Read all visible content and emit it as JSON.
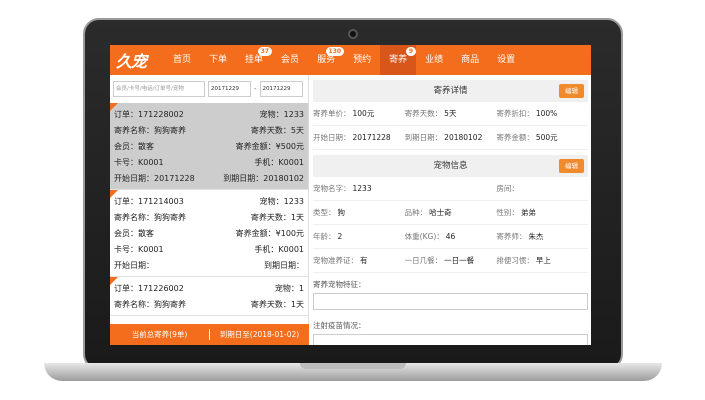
{
  "app": {
    "logo": "久宠",
    "nav": [
      {
        "label": "首页",
        "badge": null
      },
      {
        "label": "下单",
        "badge": null
      },
      {
        "label": "挂单",
        "badge": "37"
      },
      {
        "label": "会员",
        "badge": null
      },
      {
        "label": "服务",
        "badge": "130"
      },
      {
        "label": "预约",
        "badge": null
      },
      {
        "label": "寄养",
        "badge": "9"
      },
      {
        "label": "业绩",
        "badge": null
      },
      {
        "label": "商品",
        "badge": null
      },
      {
        "label": "设置",
        "badge": null
      }
    ],
    "active_nav": "寄养"
  },
  "filters": {
    "search_placeholder": "会员/卡号/电话/订单号/宠物",
    "date_from": "20171229",
    "date_sep": "-",
    "date_to": "20171229"
  },
  "orders": [
    {
      "order_label": "订单：171228002",
      "pets_label": "宠物：1233",
      "name_label": "寄养名称：狗狗寄养",
      "days_label": "寄养天数：5天",
      "member_label": "会员：散客",
      "amount_label": "寄养金额：¥500元",
      "card_label": "卡号：K0001",
      "phone_label": "手机：K0001",
      "start_label": "开始日期：20171228",
      "end_label": "到期日期：20180102"
    },
    {
      "order_label": "订单：171214003",
      "pets_label": "宠物：1233",
      "name_label": "寄养名称：狗狗寄养",
      "days_label": "寄养天数：1天",
      "member_label": "会员：散客",
      "amount_label": "寄养金额：¥100元",
      "card_label": "卡号：K0001",
      "phone_label": "手机：K0001",
      "start_label": "开始日期：",
      "end_label": "到期日期："
    },
    {
      "order_label": "订单：171226002",
      "pets_label": "宠物：1",
      "name_label": "寄养名称：狗狗寄养",
      "days_label": "寄养天数：1天"
    }
  ],
  "footer": {
    "total": "当前总寄养(9单)",
    "due": "到期日至(2018-01-02)"
  },
  "detail": {
    "title": "寄养详情",
    "edit": "编辑",
    "rows": [
      [
        {
          "k": "寄养单价：",
          "v": "100元"
        },
        {
          "k": "寄养天数：",
          "v": "5天"
        },
        {
          "k": "寄养折扣：",
          "v": "100%"
        }
      ],
      [
        {
          "k": "开始日期：",
          "v": "20171228"
        },
        {
          "k": "到期日期：",
          "v": "20180102"
        },
        {
          "k": "寄养金额：",
          "v": "500元"
        }
      ]
    ]
  },
  "pet": {
    "title": "宠物信息",
    "edit": "编辑",
    "rows": [
      [
        {
          "k": "宠物名字：",
          "v": "1233"
        },
        {
          "k": "",
          "v": ""
        },
        {
          "k": "房间：",
          "v": ""
        }
      ],
      [
        {
          "k": "类型：",
          "v": "狗"
        },
        {
          "k": "品种：",
          "v": "哈士奇"
        },
        {
          "k": "性别：",
          "v": "弟弟"
        }
      ],
      [
        {
          "k": "年龄：",
          "v": "2"
        },
        {
          "k": "体重(KG)：",
          "v": "46"
        },
        {
          "k": "寄养师：",
          "v": "朱杰"
        }
      ],
      [
        {
          "k": "宠物准养证：",
          "v": "有"
        },
        {
          "k": "一日几餐：",
          "v": "一日一餐"
        },
        {
          "k": "排便习惯：",
          "v": "早上"
        }
      ]
    ],
    "traits_label": "寄养宠物特征：",
    "vaccine_label": "注射疫苗情况："
  }
}
